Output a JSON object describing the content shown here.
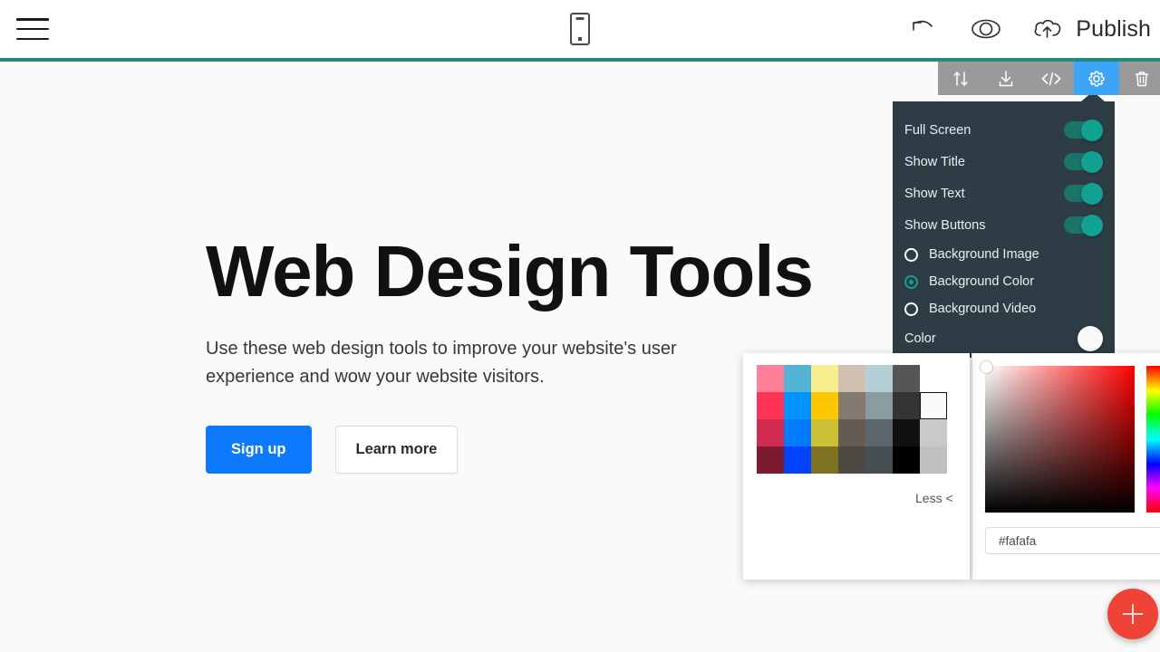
{
  "topbar": {
    "menu_icon": "hamburger-menu-icon",
    "device_icon": "mobile-preview-icon",
    "undo_icon": "undo-icon",
    "preview_icon": "eye-preview-icon",
    "publish_icon": "cloud-upload-icon",
    "publish_label": "Publish",
    "accent_bar_color": "#22897f"
  },
  "section_toolbar": {
    "active_index": 3,
    "active_bg": "#3ca5f6",
    "bar_bg": "#9a9a9a",
    "items": [
      {
        "name": "move-section-icon",
        "label": "Move"
      },
      {
        "name": "download-icon",
        "label": "Download"
      },
      {
        "name": "code-icon",
        "label": "Code"
      },
      {
        "name": "gear-icon",
        "label": "Settings"
      },
      {
        "name": "trash-icon",
        "label": "Delete"
      }
    ]
  },
  "settings_panel": {
    "bg": "#2e3d45",
    "toggle_on_color": "#11a294",
    "toggles": [
      {
        "label": "Full Screen",
        "on": true
      },
      {
        "label": "Show Title",
        "on": true
      },
      {
        "label": "Show Text",
        "on": true
      },
      {
        "label": "Show Buttons",
        "on": true
      }
    ],
    "background_options": [
      {
        "label": "Background Image",
        "selected": false
      },
      {
        "label": "Background Color",
        "selected": true
      },
      {
        "label": "Background Video",
        "selected": false
      }
    ],
    "color_row_label": "Color",
    "color_swatch_value": "#fafafa"
  },
  "color_popup": {
    "less_label": "Less <",
    "selected_swatch_index": 13,
    "swatches": [
      "#fd8099",
      "#54b4d3",
      "#f7ef8f",
      "#d0c0b2",
      "#b4cfd6",
      "#555555",
      "#ffffff",
      "#ff3355",
      "#0093ff",
      "#fec700",
      "#847a71",
      "#8b9ba2",
      "#343434",
      "#fafafa",
      "#d02b50",
      "#027bff",
      "#cbc036",
      "#645c52",
      "#5a666b",
      "#111111",
      "#c9c9c9",
      "#7c1a2f",
      "#0043fe",
      "#7c7222",
      "#4e4942",
      "#474f52",
      "#000000",
      "#bfbfbf"
    ],
    "hex_value": "#fafafa",
    "picker_hue": "#ff0000"
  },
  "hero": {
    "title": "Web Design Tools",
    "text": "Use these web design tools to improve your website's user experience and wow your website visitors.",
    "primary_button": "Sign up",
    "secondary_button": "Learn more",
    "background": "#fafafa"
  },
  "fab": {
    "name": "add-block-button",
    "color": "#f04337",
    "icon": "plus-icon"
  }
}
